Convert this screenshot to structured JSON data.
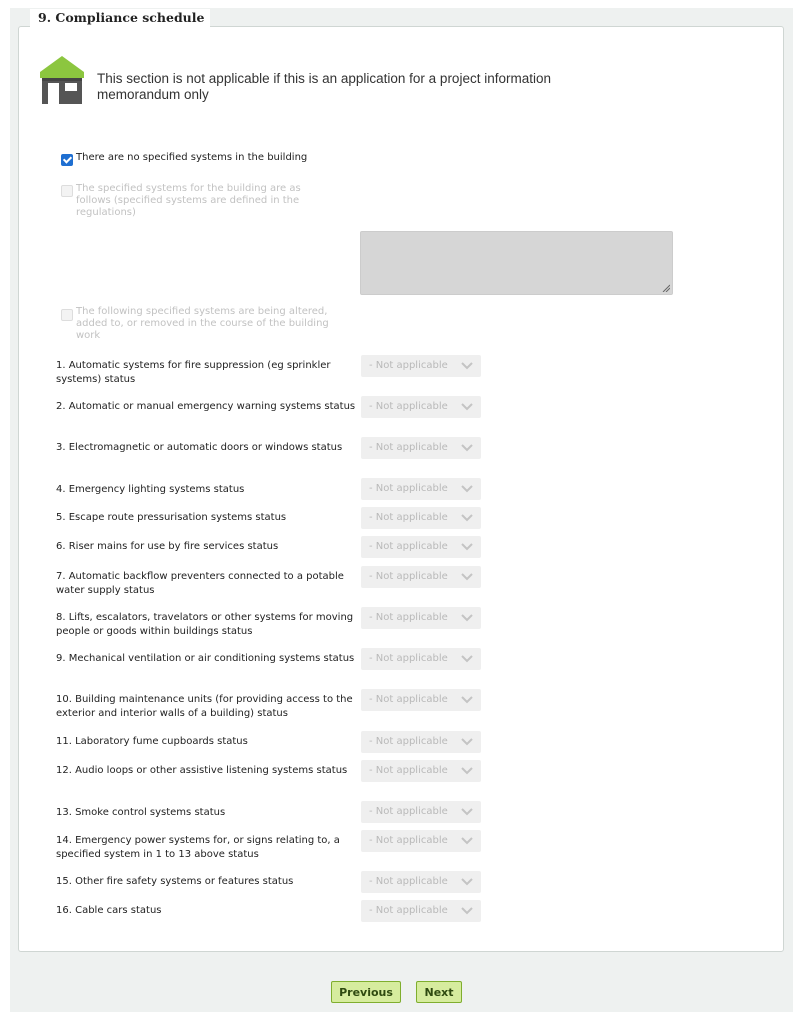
{
  "section": {
    "title": "9. Compliance schedule",
    "notice": "This section is not applicable if this is an application for a project information memorandum only",
    "notice_icon": "house-icon"
  },
  "options": {
    "no_specified_systems": {
      "label": "There are no specified systems in the building",
      "checked": true
    },
    "specified_systems": {
      "label": "The specified systems for the building are as follows (specified systems are defined in the regulations)",
      "checked": false
    },
    "systems_altered": {
      "label": "The following specified systems are being altered, added to, or removed in the course of the building work",
      "checked": false
    }
  },
  "specified_systems_text": "",
  "systems": [
    {
      "label": "1. Automatic systems for fire suppression (eg sprinkler systems) status",
      "value": "- Not applicable"
    },
    {
      "label": "2. Automatic or manual emergency warning systems status",
      "value": "- Not applicable"
    },
    {
      "label": "3. Electromagnetic or automatic doors or windows status",
      "value": "- Not applicable"
    },
    {
      "label": "4. Emergency lighting systems status",
      "value": "- Not applicable"
    },
    {
      "label": "5. Escape route pressurisation systems status",
      "value": "- Not applicable"
    },
    {
      "label": "6. Riser mains for use by fire services status",
      "value": "- Not applicable"
    },
    {
      "label": "7. Automatic backflow preventers connected to a potable water supply status",
      "value": "- Not applicable"
    },
    {
      "label": "8. Lifts, escalators, travelators or other systems for moving people or goods within buildings status",
      "value": "- Not applicable"
    },
    {
      "label": "9. Mechanical ventilation or air conditioning systems status",
      "value": "- Not applicable"
    },
    {
      "label": "10. Building maintenance units (for providing access to the exterior and interior walls of a building) status",
      "value": "- Not applicable"
    },
    {
      "label": "11. Laboratory fume cupboards status",
      "value": "- Not applicable"
    },
    {
      "label": "12. Audio loops or other assistive listening systems status",
      "value": "- Not applicable"
    },
    {
      "label": "13. Smoke control systems status",
      "value": "- Not applicable"
    },
    {
      "label": "14. Emergency power systems for, or signs relating to, a specified system in 1 to 13 above status",
      "value": "- Not applicable"
    },
    {
      "label": "15. Other fire safety systems or features status",
      "value": "- Not applicable"
    },
    {
      "label": "16. Cable cars status",
      "value": "- Not applicable"
    }
  ],
  "nav": {
    "previous_label": "Previous",
    "next_label": "Next"
  },
  "colors": {
    "button_bg": "#d6ec9e",
    "button_border": "#7fae2e",
    "checkbox_checked": "#1f6fd1",
    "house_roof": "#8cc63f",
    "house_body": "#555555"
  }
}
